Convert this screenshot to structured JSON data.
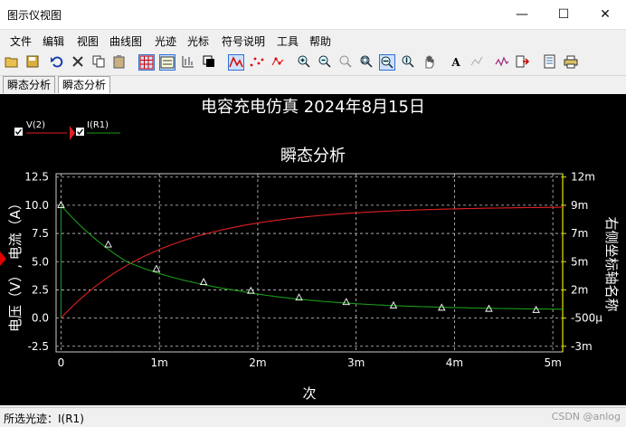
{
  "window": {
    "title": "图示仪视图",
    "minimize": "—",
    "maximize": "☐",
    "close": "✕"
  },
  "menu": [
    "文件",
    "编辑",
    "视图",
    "曲线图",
    "光迹",
    "光标",
    "符号说明",
    "工具",
    "帮助"
  ],
  "toolbar": {
    "icons": [
      "open-icon",
      "save-icon",
      "undo-icon",
      "delete-icon",
      "copy-icon",
      "paste-icon",
      "grid-icon",
      "legend-icon",
      "toggle-cursor-icon",
      "invert-colors-icon",
      "trace-line-icon",
      "trace-dots-icon",
      "trace-dots-line-icon",
      "zoom-in-icon",
      "zoom-out-icon",
      "zoom-full-icon",
      "zoom-area-icon",
      "zoom-x-icon",
      "zoom-y-icon",
      "pan-icon",
      "text-icon",
      "marker-icon",
      "fft-icon",
      "export-icon",
      "print-preview-icon",
      "print-icon"
    ],
    "active": [
      6,
      7,
      10,
      17
    ]
  },
  "tabs": [
    {
      "label": "瞬态分析",
      "active": false
    },
    {
      "label": "瞬态分析",
      "active": true
    }
  ],
  "plot": {
    "main_title": "电容充电仿真 2024年8月15日",
    "legend": [
      {
        "name": "V(2)",
        "color": "#e02020",
        "checked": true
      },
      {
        "name": "I(R1)",
        "color": "#1a9a1a",
        "checked": true
      }
    ],
    "colors": {
      "background": "#000000",
      "grid": "#c8c8c8",
      "axis_text": "#ffffff",
      "right_axis": "#e8e800"
    }
  },
  "chart_data": {
    "type": "line",
    "title": "瞬态分析",
    "xlabel": "次",
    "ylabel": "电压（V）, 电流（A）",
    "y2label": "右侧坐标轴名称",
    "x_ticks": [
      "0",
      "1m",
      "2m",
      "3m",
      "4m",
      "5m"
    ],
    "y_ticks": [
      "12.5",
      "10.0",
      "7.5",
      "5.0",
      "2.5",
      "0.0",
      "-2.5"
    ],
    "y2_ticks": [
      "12m",
      "9m",
      "7m",
      "5m",
      "2m",
      "-500μ",
      "-3m"
    ],
    "xlim": [
      -5e-05,
      0.0051
    ],
    "ylim": [
      -3,
      12.8
    ],
    "grid": true,
    "series": [
      {
        "name": "V(2)",
        "axis": "left",
        "color": "#e02020",
        "x": [
          0,
          0.00025,
          0.0005,
          0.00075,
          0.001,
          0.00125,
          0.0015,
          0.00175,
          0.002,
          0.0025,
          0.003,
          0.0035,
          0.004,
          0.0045,
          0.005
        ],
        "y": [
          0,
          2.2,
          3.9,
          5.3,
          6.3,
          7.1,
          7.8,
          8.3,
          8.65,
          9.2,
          9.5,
          9.7,
          9.8,
          9.87,
          9.9
        ]
      },
      {
        "name": "I(R1)",
        "axis": "right",
        "color": "#1a9a1a",
        "marker": "triangle",
        "x": [
          0,
          0.00048,
          0.00097,
          0.00145,
          0.00193,
          0.00242,
          0.0029,
          0.00338,
          0.00387,
          0.00435,
          0.00483
        ],
        "y": [
          0.009,
          0.0062,
          0.0042,
          0.0028,
          0.0019,
          0.0013,
          0.0009,
          0.0006,
          0.0004,
          0.0003,
          0.0002
        ]
      }
    ]
  },
  "status": {
    "selected_trace": "所选光迹：I(R1)",
    "watermark": "CSDN @anlog"
  }
}
